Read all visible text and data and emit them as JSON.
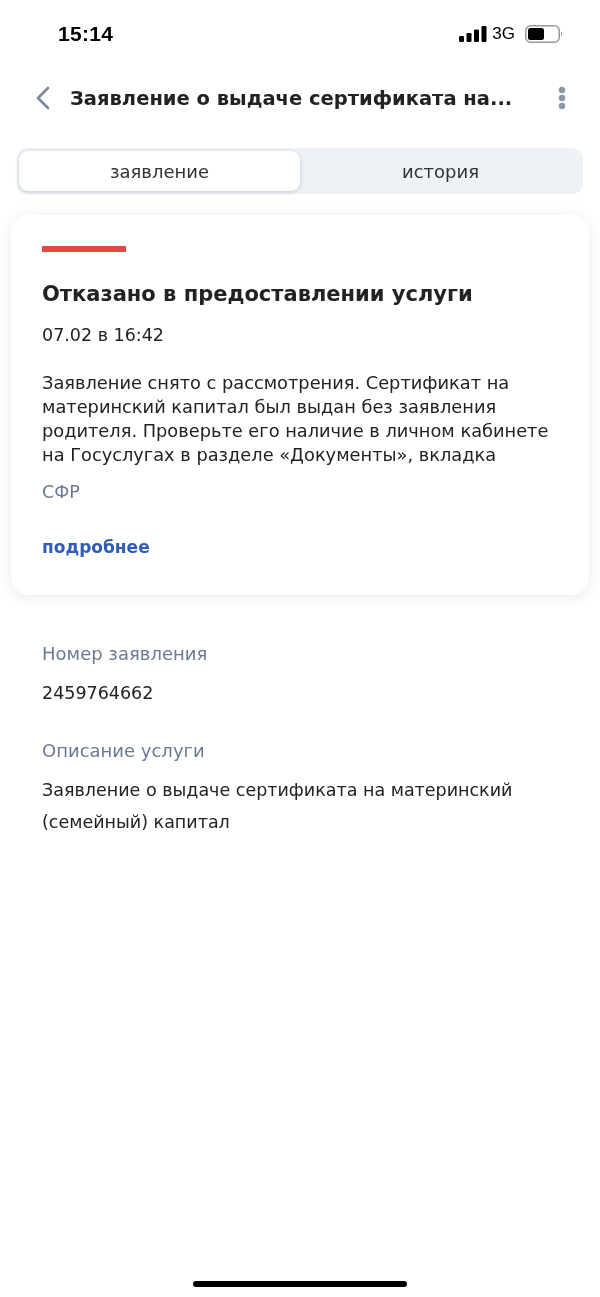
{
  "status_bar": {
    "time": "15:14",
    "network": "3G"
  },
  "nav": {
    "title": "Заявление о выдаче сертификата на..."
  },
  "tabs": [
    {
      "label": "заявление",
      "selected": true
    },
    {
      "label": "история",
      "selected": false
    }
  ],
  "status_card": {
    "kind": "rejected",
    "status": "Отказано в предоставлении услуги",
    "date": "07.02 в 16:42",
    "message": "Заявление снято с рассмотрения. Сертификат на материнский капитал был выдан без заявления родителя. Проверьте его наличие в личном кабинете на Госуслугах в разделе «Документы», вкладка",
    "department": "СФР",
    "link": "подробнее"
  },
  "details": [
    {
      "label": "Номер заявления",
      "value": "2459764662"
    },
    {
      "label": "Описание услуги",
      "value": "Заявление о выдаче сертификата на материнский (семейный) капитал"
    }
  ]
}
